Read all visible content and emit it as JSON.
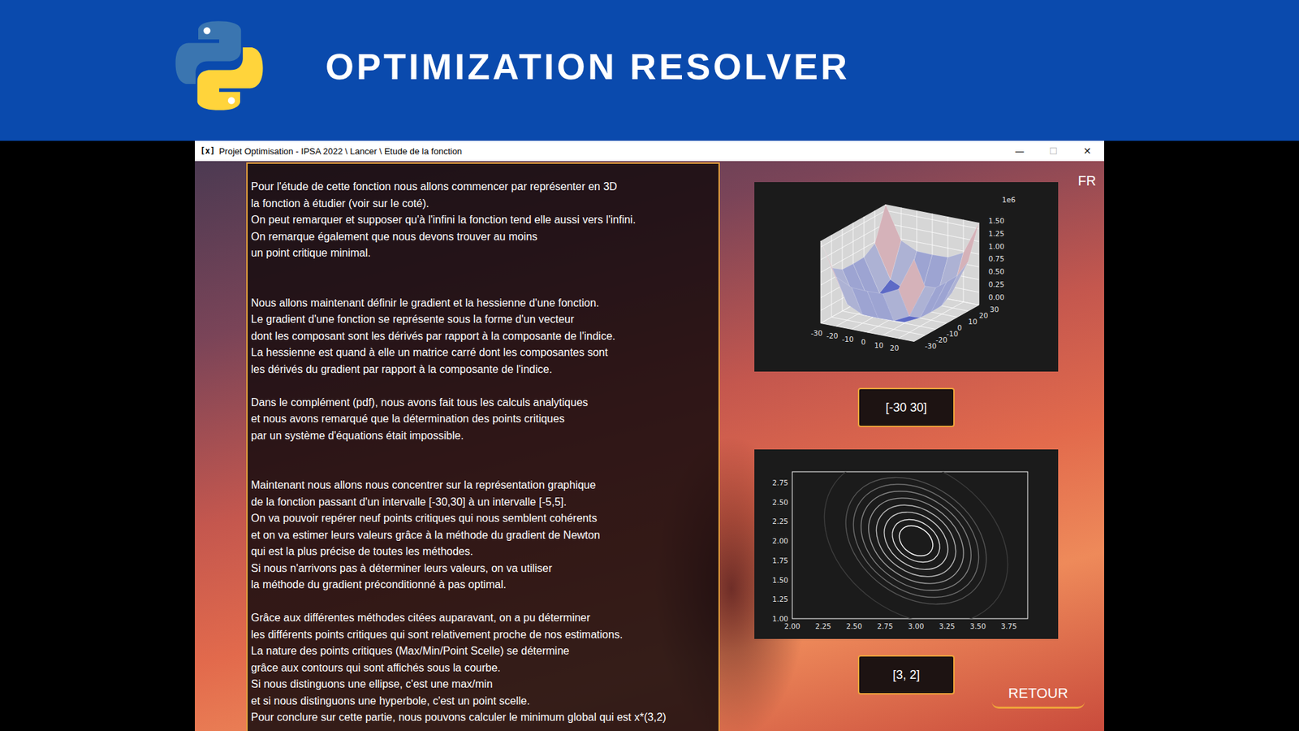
{
  "banner": {
    "title": "OPTIMIZATION RESOLVER"
  },
  "window": {
    "icon": "[x]",
    "title": "Projet Optimisation - IPSA 2022 \\ Lancer \\ Etude de la fonction",
    "controls": [
      {
        "glyph": "—",
        "disabled": false
      },
      {
        "glyph": "☐",
        "disabled": true
      },
      {
        "glyph": "✕",
        "disabled": false
      }
    ]
  },
  "language_button": "FR",
  "text_panel": {
    "paragraphs": [
      [
        "Pour l'étude de cette fonction nous allons commencer par représenter en 3D",
        "la fonction à étudier (voir sur le coté).",
        "On peut remarquer et supposer qu'à l'infini la fonction tend elle aussi vers l'infini.",
        "On remarque également que nous devons trouver au moins",
        "un point critique minimal."
      ],
      [
        "Nous allons maintenant définir le gradient et la hessienne d'une fonction.",
        "Le gradient d'une fonction se représente sous la forme d'un vecteur",
        "dont les composant sont les dérivés par rapport à la composante de l'indice.",
        "La hessienne est quand à elle un matrice carré dont les composantes sont",
        "les dérivés du gradient par rapport à la composante de l'indice."
      ],
      [
        "Dans le complément (pdf), nous avons fait tous les calculs analytiques",
        "et nous avons remarqué que la détermination des points critiques",
        "par un système d'équations était impossible."
      ],
      [
        "Maintenant nous allons nous concentrer sur la représentation graphique",
        "de la fonction passant d'un intervalle [-30,30] à un intervalle [-5,5].",
        "On va pouvoir repérer neuf points critiques qui nous semblent cohérents",
        "et on va estimer leurs valeurs grâce à la méthode du gradient de Newton",
        "qui est la plus précise de toutes les méthodes.",
        "Si nous n'arrivons pas à déterminer leurs valeurs, on va utiliser",
        "la méthode du gradient préconditionné à pas optimal."
      ],
      [
        "Grâce aux différentes méthodes citées auparavant, on a pu déterminer",
        "les différents points critiques qui sont relativement proche de nos estimations.",
        "La nature des points critiques (Max/Min/Point Scelle) se détermine",
        "grâce aux contours qui sont affichés sous la courbe.",
        "Si nous distinguons une ellipse, c'est une max/min",
        "et si nous distinguons une hyperbole, c'est un point scelle.",
        "Pour conclure sur cette partie, nous pouvons calculer le minimum global qui est x*(3,2)"
      ]
    ]
  },
  "surface_plot": {
    "x": [
      -30,
      -20,
      -10,
      0,
      10,
      20,
      30
    ],
    "y": [
      -30,
      -20,
      -10,
      0,
      10,
      20,
      30
    ],
    "z": [
      [
        1.62,
        0.97,
        0.82,
        0.81,
        0.82,
        0.97,
        1.62
      ],
      [
        0.97,
        0.32,
        0.17,
        0.16,
        0.17,
        0.32,
        0.97
      ],
      [
        0.82,
        0.17,
        0.02,
        0.01,
        0.02,
        0.17,
        0.82
      ],
      [
        0.81,
        0.16,
        0.01,
        0.0,
        0.01,
        0.16,
        0.81
      ],
      [
        0.82,
        0.17,
        0.02,
        0.01,
        0.02,
        0.17,
        0.82
      ],
      [
        0.97,
        0.32,
        0.17,
        0.16,
        0.17,
        0.32,
        0.97
      ],
      [
        1.62,
        0.97,
        0.82,
        0.81,
        0.82,
        0.97,
        1.62
      ]
    ],
    "z_scale_label": "1e6",
    "z_ticks": [
      "0.00",
      "0.25",
      "0.50",
      "0.75",
      "1.00",
      "1.25",
      "1.50"
    ],
    "x_ticks": [
      "-30",
      "-20",
      "-10",
      "0",
      "10",
      "20"
    ],
    "y_ticks": [
      "30",
      "20",
      "10",
      "0",
      "-10",
      "-20",
      "-30"
    ]
  },
  "range_button": "[-30 30]",
  "contour_plot": {
    "center": [
      3,
      2
    ],
    "levels": [
      0.25,
      0.5,
      0.9,
      1.4,
      2.0,
      2.7,
      3.5,
      4.4,
      7.5
    ],
    "x_ticks": [
      "2.00",
      "2.25",
      "2.50",
      "2.75",
      "3.00",
      "3.25",
      "3.50",
      "3.75"
    ],
    "y_ticks": [
      "1.00",
      "1.25",
      "1.50",
      "1.75",
      "2.00",
      "2.25",
      "2.50",
      "2.75"
    ]
  },
  "minimum_button": "[3, 2]",
  "back_button": "RETOUR"
}
